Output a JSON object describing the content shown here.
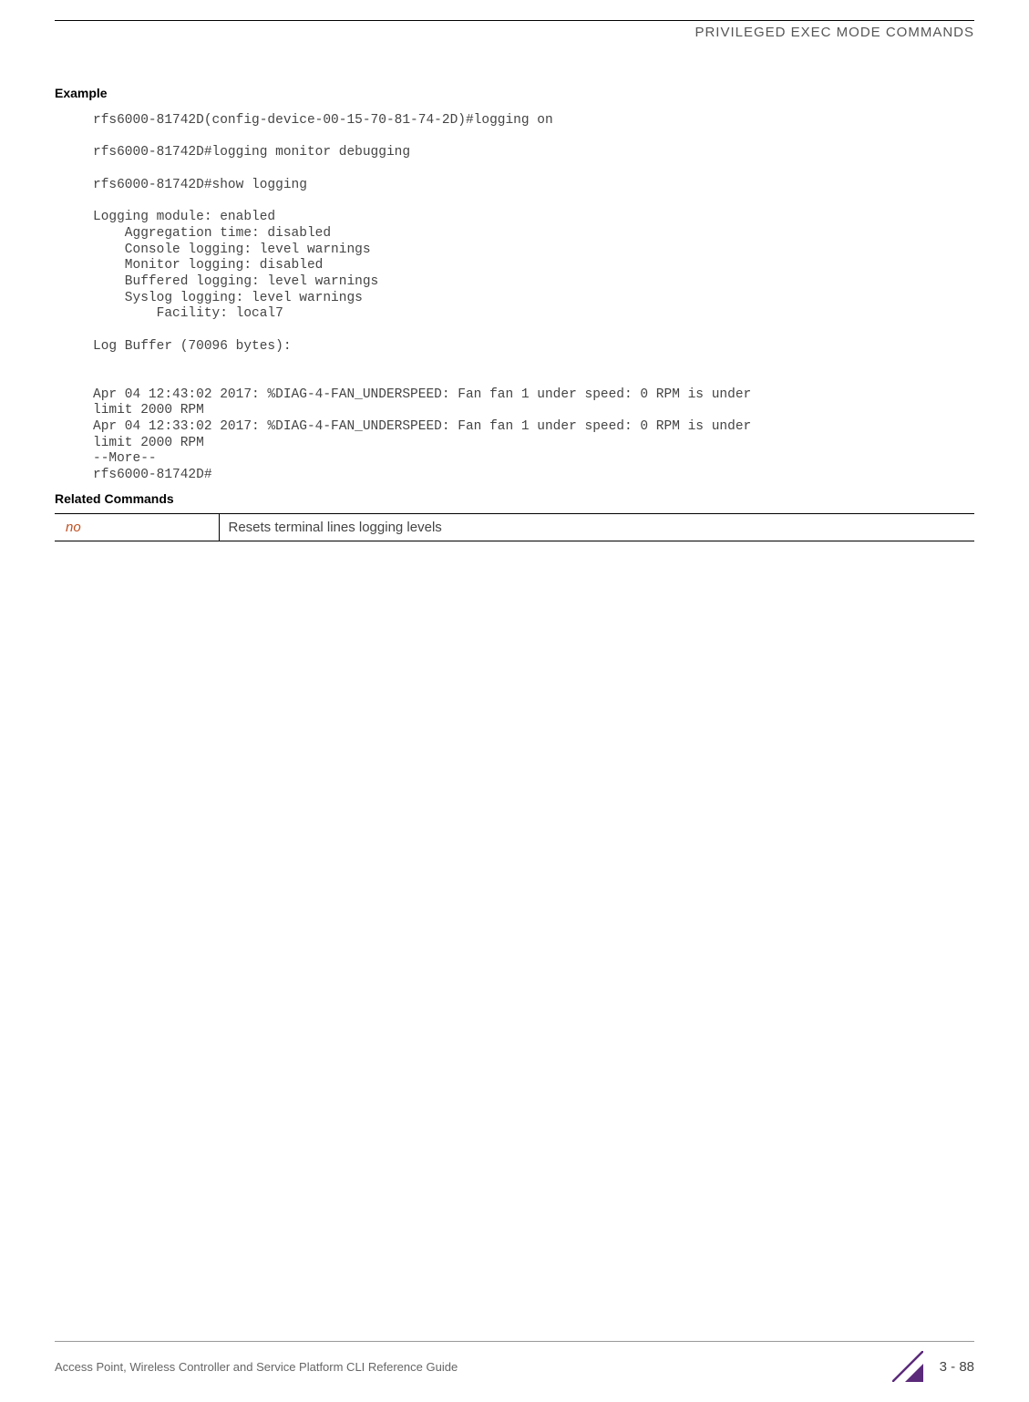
{
  "header": {
    "title": "PRIVILEGED EXEC MODE COMMANDS"
  },
  "sections": {
    "example_heading": "Example",
    "code": "rfs6000-81742D(config-device-00-15-70-81-74-2D)#logging on\n\nrfs6000-81742D#logging monitor debugging\n\nrfs6000-81742D#show logging\n\nLogging module: enabled\n    Aggregation time: disabled\n    Console logging: level warnings\n    Monitor logging: disabled\n    Buffered logging: level warnings\n    Syslog logging: level warnings\n        Facility: local7\n\nLog Buffer (70096 bytes):\n\n\nApr 04 12:43:02 2017: %DIAG-4-FAN_UNDERSPEED: Fan fan 1 under speed: 0 RPM is under \nlimit 2000 RPM\nApr 04 12:33:02 2017: %DIAG-4-FAN_UNDERSPEED: Fan fan 1 under speed: 0 RPM is under \nlimit 2000 RPM\n--More--\nrfs6000-81742D#",
    "related_heading": "Related Commands",
    "related": {
      "cmd": "no",
      "desc": "Resets terminal lines logging levels"
    }
  },
  "footer": {
    "left": "Access Point, Wireless Controller and Service Platform CLI Reference Guide",
    "page": "3 - 88"
  }
}
